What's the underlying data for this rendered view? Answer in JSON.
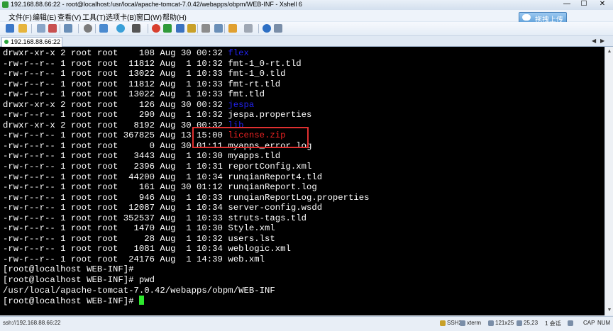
{
  "window": {
    "title": "192.168.88.66:22 - root@localhost:/usr/local/apache-tomcat-7.0.42/webapps/obpm/WEB-INF - Xshell 6",
    "minimize": "—",
    "maximize": "☐",
    "close": "✕"
  },
  "menu": [
    "文件(F)",
    "编辑(E)",
    "查看(V)",
    "工具(T)",
    "选项卡(B)",
    "窗口(W)",
    "帮助(H)"
  ],
  "upload_button": "拖拽上传",
  "session_tab": "192.168.88.66:22",
  "terminal": {
    "lines": [
      {
        "p": "drwxr-xr-x 2 root root    108 Aug 30 00:32 ",
        "n": "flex",
        "t": "dir"
      },
      {
        "p": "-rw-r--r-- 1 root root  11812 Aug  1 10:32 ",
        "n": "fmt-1_0-rt.tld",
        "t": "file"
      },
      {
        "p": "-rw-r--r-- 1 root root  13022 Aug  1 10:33 ",
        "n": "fmt-1_0.tld",
        "t": "file"
      },
      {
        "p": "-rw-r--r-- 1 root root  11812 Aug  1 10:33 ",
        "n": "fmt-rt.tld",
        "t": "file"
      },
      {
        "p": "-rw-r--r-- 1 root root  13022 Aug  1 10:33 ",
        "n": "fmt.tld",
        "t": "file"
      },
      {
        "p": "drwxr-xr-x 2 root root    126 Aug 30 00:32 ",
        "n": "jespa",
        "t": "dir"
      },
      {
        "p": "-rw-r--r-- 1 root root    290 Aug  1 10:32 ",
        "n": "jespa.properties",
        "t": "file"
      },
      {
        "p": "drwxr-xr-x 2 root root   8192 Aug 30 00:32 ",
        "n": "lib",
        "t": "dir"
      },
      {
        "p": "-rw-r--r-- 1 root root 367825 Aug 13 15:00 ",
        "n": "license.zip",
        "t": "zip"
      },
      {
        "p": "-rw-r--r-- 1 root root      0 Aug 30 01:11 ",
        "n": "myapps_error.log",
        "t": "file"
      },
      {
        "p": "-rw-r--r-- 1 root root   3443 Aug  1 10:30 ",
        "n": "myapps.tld",
        "t": "file"
      },
      {
        "p": "-rw-r--r-- 1 root root   2396 Aug  1 10:31 ",
        "n": "reportConfig.xml",
        "t": "file"
      },
      {
        "p": "-rw-r--r-- 1 root root  44200 Aug  1 10:34 ",
        "n": "runqianReport4.tld",
        "t": "file"
      },
      {
        "p": "-rw-r--r-- 1 root root    161 Aug 30 01:12 ",
        "n": "runqianReport.log",
        "t": "file"
      },
      {
        "p": "-rw-r--r-- 1 root root    946 Aug  1 10:33 ",
        "n": "runqianReportLog.properties",
        "t": "file"
      },
      {
        "p": "-rw-r--r-- 1 root root  12087 Aug  1 10:34 ",
        "n": "server-config.wsdd",
        "t": "file"
      },
      {
        "p": "-rw-r--r-- 1 root root 352537 Aug  1 10:33 ",
        "n": "struts-tags.tld",
        "t": "file"
      },
      {
        "p": "-rw-r--r-- 1 root root   1470 Aug  1 10:30 ",
        "n": "Style.xml",
        "t": "file"
      },
      {
        "p": "-rw-r--r-- 1 root root     28 Aug  1 10:32 ",
        "n": "users.lst",
        "t": "file"
      },
      {
        "p": "-rw-r--r-- 1 root root   1081 Aug  1 10:34 ",
        "n": "weblogic.xml",
        "t": "file"
      },
      {
        "p": "-rw-r--r-- 1 root root  24176 Aug  1 14:39 ",
        "n": "web.xml",
        "t": "file"
      },
      {
        "p": "[root@localhost WEB-INF]#",
        "n": "",
        "t": "plain"
      },
      {
        "p": "[root@localhost WEB-INF]# pwd",
        "n": "",
        "t": "plain"
      },
      {
        "p": "/usr/local/apache-tomcat-7.0.42/webapps/obpm/WEB-INF",
        "n": "",
        "t": "plain"
      }
    ],
    "prompt": "[root@localhost WEB-INF]# "
  },
  "status": {
    "connection": "ssh://192.168.88.66:22",
    "protocol": "SSH2",
    "terminal_type": "xterm",
    "size": "121x25",
    "cursor_pos": "25,23",
    "sessions": "1 会话",
    "caps": "CAP",
    "num": "NUM"
  },
  "colors": {
    "terminal_bg": "#000000",
    "terminal_fg": "#ffffff",
    "directory": "#2222ee",
    "archive": "#ee2222",
    "cursor": "#2ee82e",
    "highlight_box": "#e03030"
  },
  "icons": [
    "app-icon",
    "new-session-icon",
    "open-folder-icon",
    "reconnect-icon",
    "disconnect-icon",
    "copy-icon",
    "paste-icon",
    "find-icon",
    "properties-icon",
    "color-scheme-icon",
    "font-icon",
    "xftp-icon",
    "xmanager-icon",
    "lock-icon",
    "keyboard-icon",
    "compose-icon",
    "layout-icon",
    "help-icon",
    "cloud-upload-icon"
  ]
}
